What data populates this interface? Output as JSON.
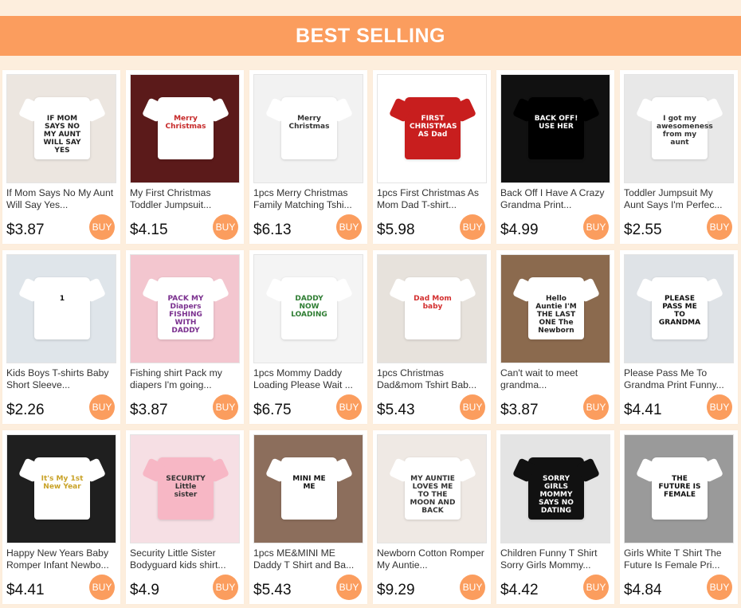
{
  "header": {
    "title": "BEST SELLING"
  },
  "buy_label": "BUY",
  "colors": {
    "accent": "#fb9d5e",
    "background": "#fdeedd"
  },
  "products": [
    {
      "title": "If Mom Says No My Aunt Will Say Yes...",
      "price": "$3.87",
      "image": {
        "bg": "#ece6e0",
        "shirt": "#ffffff",
        "ink": "#222222",
        "text": "IF MOM SAYS NO MY AUNT WILL SAY YES"
      }
    },
    {
      "title": "My First Christmas Toddler Jumpsuit...",
      "price": "$4.15",
      "image": {
        "bg": "#5b1a1a",
        "shirt": "#ffffff",
        "ink": "#c62828",
        "text": "Merry Christmas"
      }
    },
    {
      "title": "1pcs Merry Christmas Family Matching Tshi...",
      "price": "$6.13",
      "image": {
        "bg": "#f2f2f2",
        "shirt": "#ffffff",
        "ink": "#333333",
        "text": "Merry Christmas"
      }
    },
    {
      "title": "1pcs First Christmas As Mom Dad T-shirt...",
      "price": "$5.98",
      "image": {
        "bg": "#ffffff",
        "shirt": "#c81e1e",
        "ink": "#ffffff",
        "text": "FIRST CHRISTMAS AS Dad"
      }
    },
    {
      "title": "Back Off I Have A Crazy Grandma Print...",
      "price": "$4.99",
      "image": {
        "bg": "#111111",
        "shirt": "#000000",
        "ink": "#ffffff",
        "text": "BACK OFF! USE HER"
      }
    },
    {
      "title": "Toddler Jumpsuit My Aunt Says I'm Perfec...",
      "price": "$2.55",
      "image": {
        "bg": "#e8e8e8",
        "shirt": "#ffffff",
        "ink": "#333333",
        "text": "I got my awesomeness from my aunt"
      }
    },
    {
      "title": "Kids Boys T-shirts Baby Short Sleeve...",
      "price": "$2.26",
      "image": {
        "bg": "#dfe5ea",
        "shirt": "#ffffff",
        "ink": "#111111",
        "text": "1"
      }
    },
    {
      "title": "Fishing shirt Pack my diapers I'm going...",
      "price": "$3.87",
      "image": {
        "bg": "#f3c6cf",
        "shirt": "#ffffff",
        "ink": "#7a2f8e",
        "text": "PACK MY Diapers FISHING WITH DADDY"
      }
    },
    {
      "title": "1pcs Mommy Daddy Loading Please Wait ...",
      "price": "$6.75",
      "image": {
        "bg": "#f4f4f4",
        "shirt": "#ffffff",
        "ink": "#2e7d32",
        "text": "DADDY NOW LOADING"
      }
    },
    {
      "title": "1pcs Christmas Dad&mom Tshirt Bab...",
      "price": "$5.43",
      "image": {
        "bg": "#e7e2dc",
        "shirt": "#ffffff",
        "ink": "#d32f2f",
        "text": "Dad Mom baby"
      }
    },
    {
      "title": "Can't wait to meet grandma...",
      "price": "$3.87",
      "image": {
        "bg": "#8b6a4e",
        "shirt": "#ffffff",
        "ink": "#222222",
        "text": "Hello Auntie I'M THE LAST ONE The Newborn"
      }
    },
    {
      "title": "Please Pass Me To Grandma Print Funny...",
      "price": "$4.41",
      "image": {
        "bg": "#dfe3e7",
        "shirt": "#ffffff",
        "ink": "#111111",
        "text": "PLEASE PASS ME TO GRANDMA"
      }
    },
    {
      "title": "Happy New Years Baby Romper Infant Newbo...",
      "price": "$4.41",
      "image": {
        "bg": "#1f1f1f",
        "shirt": "#ffffff",
        "ink": "#c9a227",
        "text": "It's My 1st New Year"
      }
    },
    {
      "title": "Security Little Sister Bodyguard kids shirt...",
      "price": "$4.9",
      "image": {
        "bg": "#f6dfe4",
        "shirt": "#f7b7c5",
        "ink": "#333333",
        "text": "SECURITY Little sister"
      }
    },
    {
      "title": "1pcs ME&MINI ME Daddy T Shirt and Ba...",
      "price": "$5.43",
      "image": {
        "bg": "#8c6e5c",
        "shirt": "#ffffff",
        "ink": "#111111",
        "text": "MINI ME ME"
      }
    },
    {
      "title": "Newborn Cotton Romper My Auntie...",
      "price": "$9.29",
      "image": {
        "bg": "#efe9e4",
        "shirt": "#ffffff",
        "ink": "#333333",
        "text": "MY AUNTIE LOVES ME TO THE MOON AND BACK"
      }
    },
    {
      "title": "Children Funny T Shirt Sorry Girls Mommy...",
      "price": "$4.42",
      "image": {
        "bg": "#e4e4e4",
        "shirt": "#111111",
        "ink": "#ffffff",
        "text": "SORRY GIRLS MOMMY SAYS NO DATING"
      }
    },
    {
      "title": "Girls White T Shirt The Future Is Female Pri...",
      "price": "$4.84",
      "image": {
        "bg": "#9a9a9a",
        "shirt": "#ffffff",
        "ink": "#111111",
        "text": "THE FUTURE IS FEMALE"
      }
    }
  ]
}
